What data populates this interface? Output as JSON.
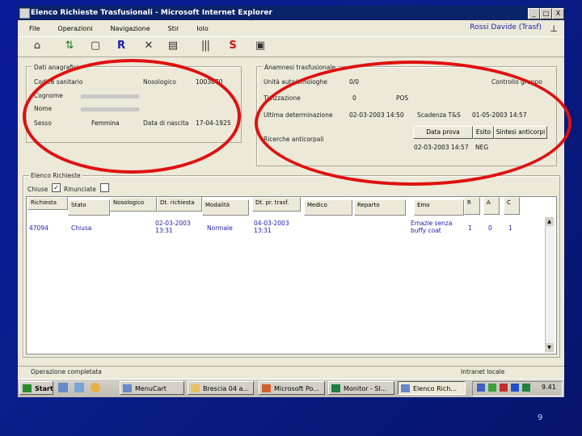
{
  "window": {
    "title": "Elenco Richieste Trasfusionali - Microsoft Internet Explorer",
    "min": "_",
    "max": "□",
    "close": "X"
  },
  "menu": [
    "File",
    "Operazioni",
    "Navigazione",
    "Stir",
    "Iolo"
  ],
  "user": "Rossi Davide (Trasf)",
  "toolbar_icons": [
    "home-icon",
    "refresh-icon",
    "new-doc-icon",
    "r-icon",
    "delete-icon",
    "print-icon",
    "barcode-icon",
    "s-icon",
    "form-icon"
  ],
  "anagrafici": {
    "legend": "Dati anagrafici",
    "codice_label": "Codice sanitario",
    "nosologico_label": "Nosologico",
    "nosologico_value": "1003070",
    "cognome_label": "Cognome",
    "cognome_value": "",
    "nome_label": "Nome",
    "sesso_label": "Sesso",
    "sesso_value": "Femmina",
    "nascita_label": "Data di nascita",
    "nascita_value": "17-04-1925"
  },
  "anamnesi": {
    "legend": "Anamnesi trasfusionale",
    "unita_label": "Unità auto/omologhe",
    "unita_value": "0/0",
    "controllo_label": "Controllo gruppo",
    "tipizzazione_label": "Tipizzazione",
    "tip_value1": "0",
    "tip_value2": "POS",
    "ultima_label": "Ultima determinazione",
    "ultima_value": "02-03-2003 14:50",
    "scadenza_label": "Scadenza T&S",
    "scadenza_value": "01-05-2003 14:57",
    "ricerca_label": "Ricerche anticorpali",
    "btn_data": "Data prova",
    "btn_esito": "Esito",
    "btn_sintesi": "Sintesi anticorpi",
    "ric_data": "02-03-2003 14:57",
    "ric_esito": "NEG"
  },
  "elenco": {
    "legend": "Elenco Richieste",
    "chiuse_label": "Chiuse",
    "chiuse_check": "✓",
    "rinunciate_label": "Rinunciate",
    "headers": [
      "Richiesta",
      "Stato",
      "Nosologico",
      "Dt. richiesta",
      "Modalità",
      "Dt. pr. trasf.",
      "Medico",
      "Reparto",
      "Emo",
      "R",
      "A",
      "C"
    ],
    "row": {
      "richiesta": "47094",
      "stato": "Chiusa",
      "dt_richiesta": "02-03-2003 13:31",
      "modalita": "Normale",
      "dt_trasf": "04-03-2003 13:31",
      "emo": "Emazie senza buffy coat",
      "r": "1",
      "a": "0",
      "c": "1"
    }
  },
  "status": {
    "text": "Operazione completata",
    "zone": "Intranet locale"
  },
  "taskbar": {
    "start": "Start",
    "tasks": [
      "MenuCart",
      "Brescia 04 a...",
      "Microsoft Po...",
      "Monitor - SI...",
      "Elenco Rich..."
    ],
    "clock": "9.41"
  },
  "slide_number": "9",
  "accent": {
    "title_blue": "#0a246a",
    "annotation_red": "#e01010"
  }
}
